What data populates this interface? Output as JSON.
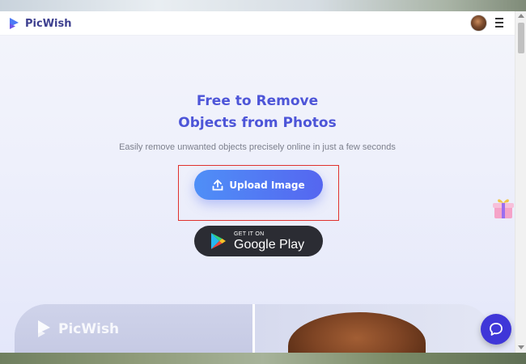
{
  "navbar": {
    "brand": "PicWish",
    "avatar_icon": "user-avatar",
    "menu_icon": "hamburger-menu-icon"
  },
  "hero": {
    "title_line1": "Free to Remove",
    "title_line2": "Objects from Photos",
    "subtitle": "Easily remove unwanted objects precisely online in just a few seconds",
    "upload_label": "Upload Image",
    "upload_icon": "upload-icon",
    "gplay_small": "GET IT ON",
    "gplay_big": "Google Play",
    "gplay_icon": "google-play-icon",
    "gift_icon": "gift-box-icon"
  },
  "preview": {
    "brand": "PicWish"
  },
  "chat": {
    "icon": "chat-bubble-icon"
  },
  "colors": {
    "accent": "#4d55d8",
    "button_gradient_start": "#4f8ff7",
    "button_gradient_end": "#5566f0",
    "gplay_bg": "#2b2c33",
    "highlight_border": "#e0322e",
    "chat_bg": "#3f36d8"
  }
}
